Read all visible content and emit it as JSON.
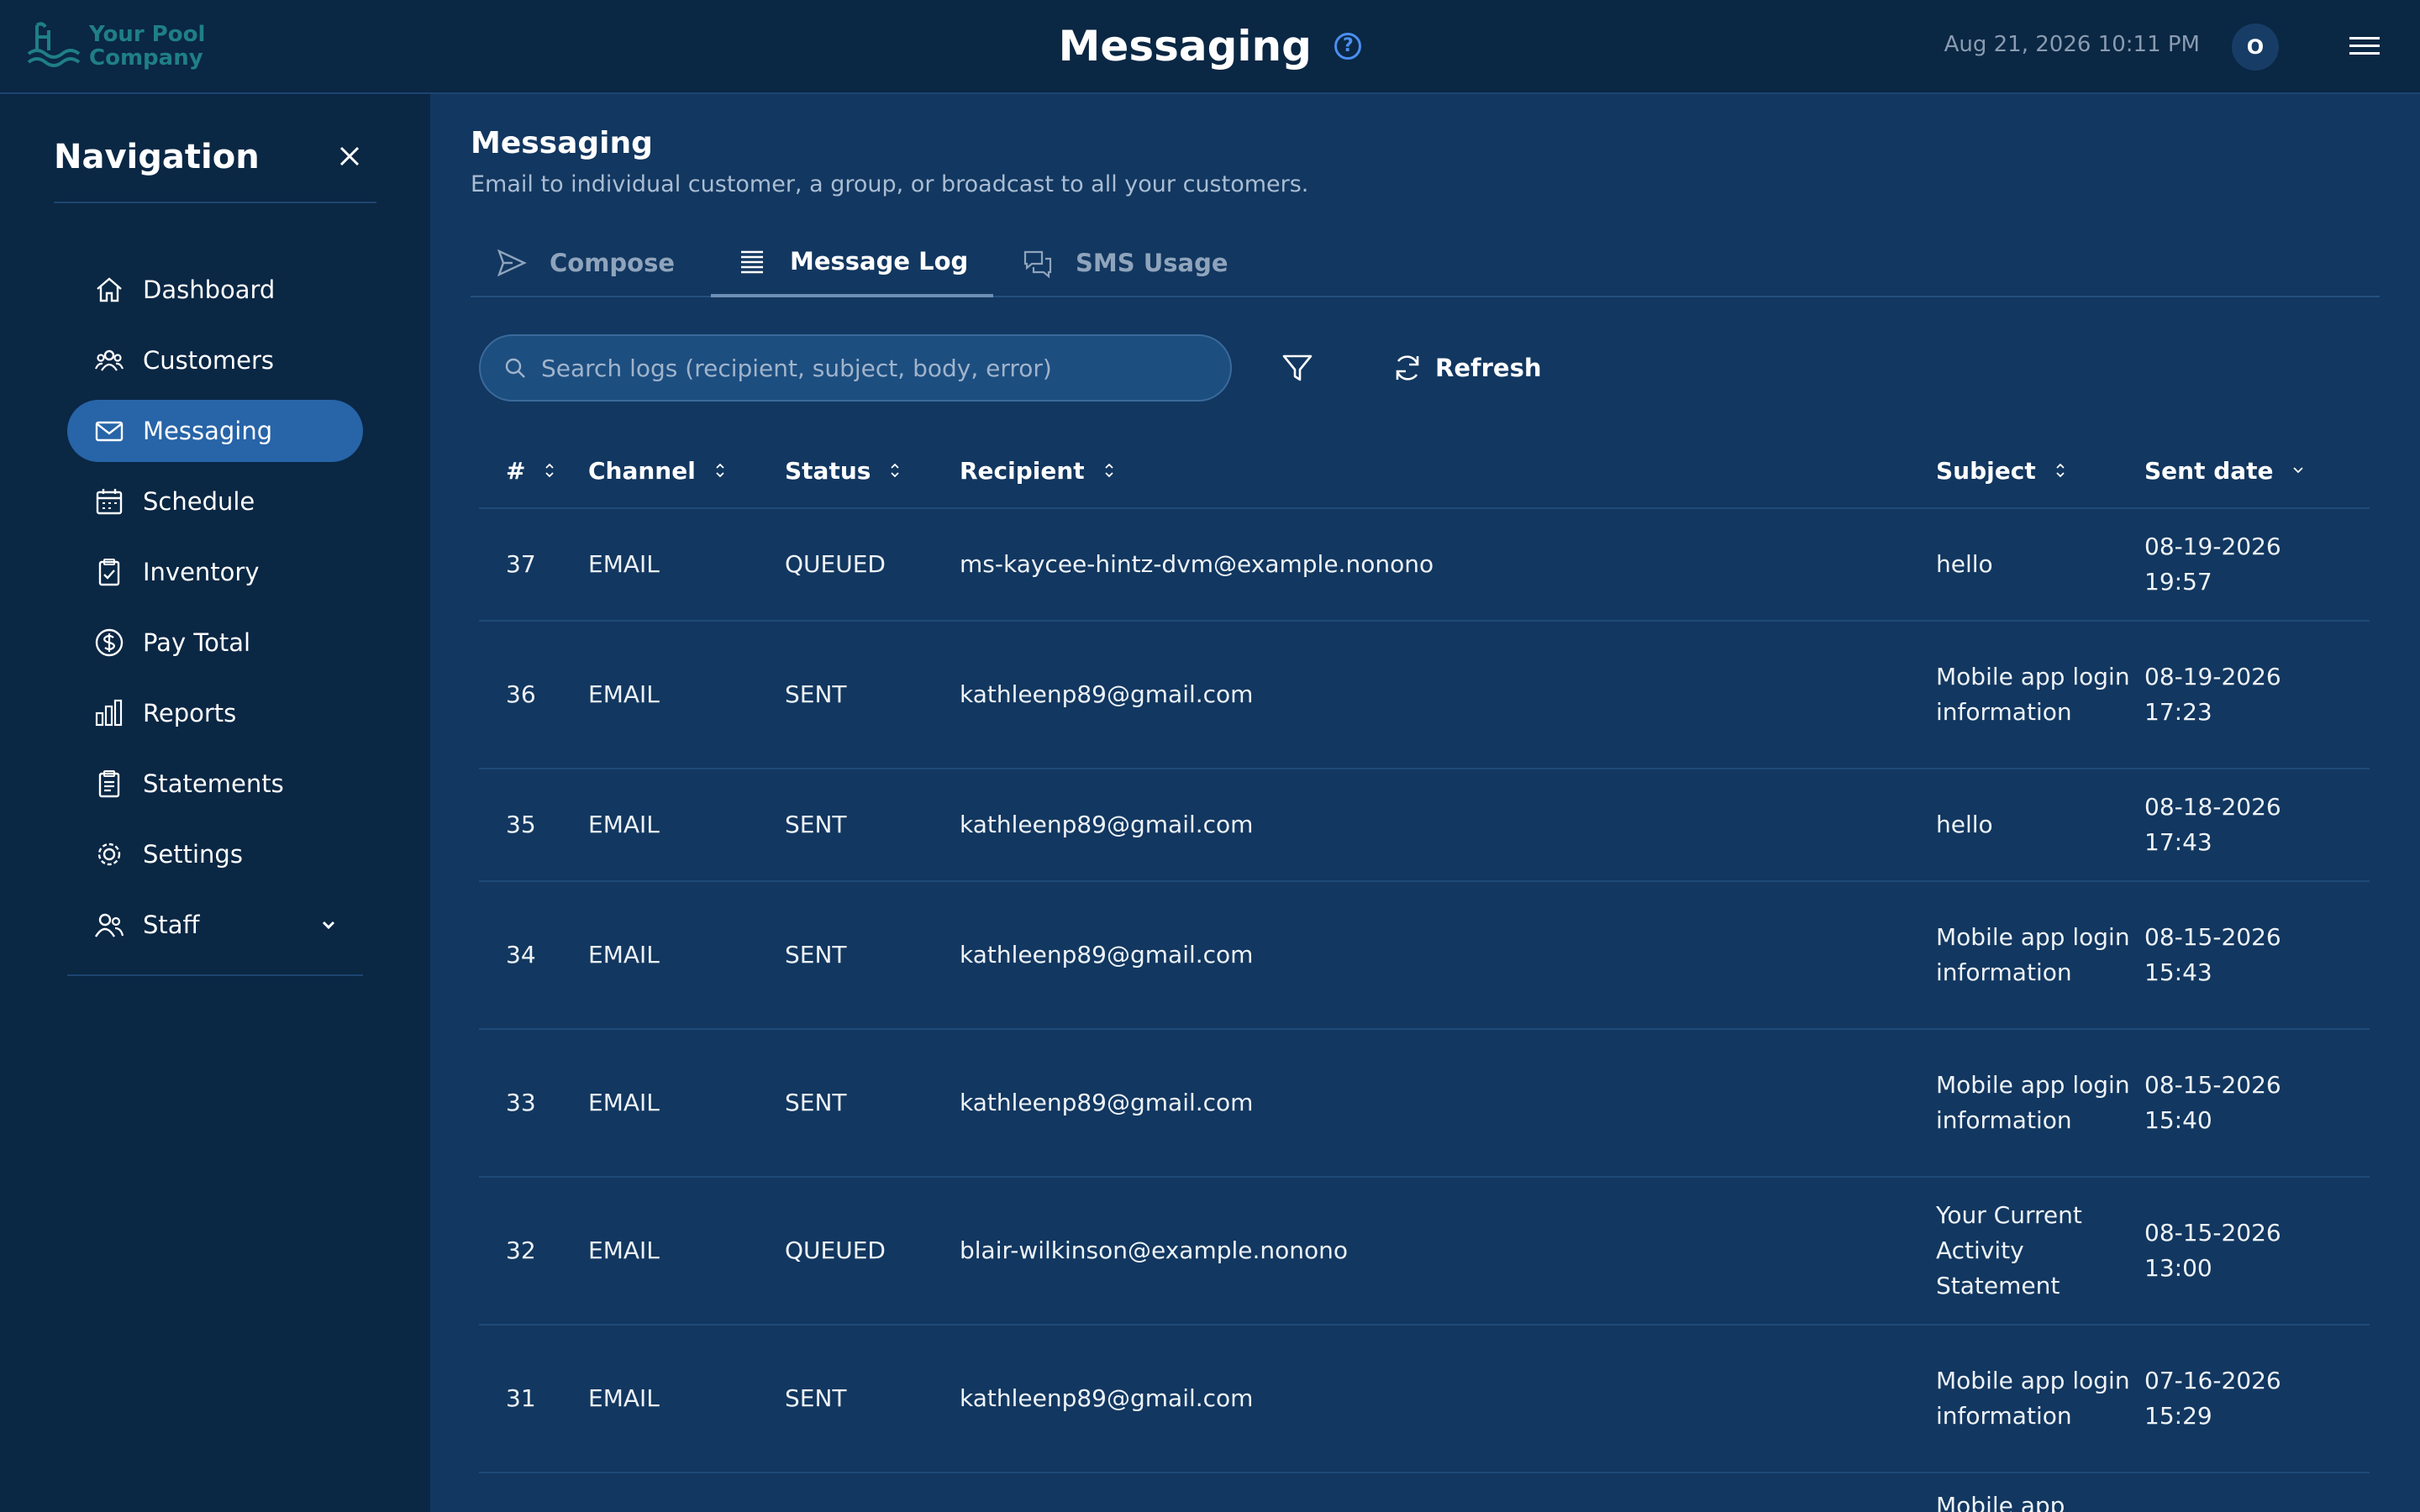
{
  "header": {
    "logo_line1": "Your Pool",
    "logo_line2": "Company",
    "title": "Messaging",
    "help_symbol": "?",
    "datetime": "Aug 21, 2026 10:11 PM",
    "avatar_initial": "O"
  },
  "sidebar": {
    "title": "Navigation",
    "items": [
      {
        "label": "Dashboard",
        "icon": "home-icon"
      },
      {
        "label": "Customers",
        "icon": "users-icon"
      },
      {
        "label": "Messaging",
        "icon": "mail-icon",
        "active": true
      },
      {
        "label": "Schedule",
        "icon": "calendar-icon"
      },
      {
        "label": "Inventory",
        "icon": "clipboard-check-icon"
      },
      {
        "label": "Pay Total",
        "icon": "dollar-icon"
      },
      {
        "label": "Reports",
        "icon": "bar-chart-icon"
      },
      {
        "label": "Statements",
        "icon": "statements-icon"
      },
      {
        "label": "Settings",
        "icon": "gear-icon"
      },
      {
        "label": "Staff",
        "icon": "staff-icon",
        "expandable": true
      }
    ]
  },
  "main": {
    "title": "Messaging",
    "subtitle": "Email to individual customer, a group, or broadcast to all your customers.",
    "tabs": [
      {
        "label": "Compose",
        "icon": "send-icon"
      },
      {
        "label": "Message Log",
        "icon": "list-icon",
        "active": true
      },
      {
        "label": "SMS Usage",
        "icon": "chat-icon"
      }
    ],
    "search_placeholder": "Search logs (recipient, subject, body, error)",
    "refresh_label": "Refresh"
  },
  "table": {
    "columns": [
      "#",
      "Channel",
      "Status",
      "Recipient",
      "Subject",
      "Sent date"
    ],
    "rows": [
      {
        "num": "37",
        "channel": "EMAIL",
        "status": "QUEUED",
        "recipient": "ms-kaycee-hintz-dvm@example.nonono",
        "subject": "hello",
        "date": "08-19-2026",
        "time": "19:57"
      },
      {
        "num": "36",
        "channel": "EMAIL",
        "status": "SENT",
        "recipient": "kathleenp89@gmail.com",
        "subject": "Mobile app login information",
        "date": "08-19-2026",
        "time": "17:23"
      },
      {
        "num": "35",
        "channel": "EMAIL",
        "status": "SENT",
        "recipient": "kathleenp89@gmail.com",
        "subject": "hello",
        "date": "08-18-2026",
        "time": "17:43"
      },
      {
        "num": "34",
        "channel": "EMAIL",
        "status": "SENT",
        "recipient": "kathleenp89@gmail.com",
        "subject": "Mobile app login information",
        "date": "08-15-2026",
        "time": "15:43"
      },
      {
        "num": "33",
        "channel": "EMAIL",
        "status": "SENT",
        "recipient": "kathleenp89@gmail.com",
        "subject": "Mobile app login information",
        "date": "08-15-2026",
        "time": "15:40"
      },
      {
        "num": "32",
        "channel": "EMAIL",
        "status": "QUEUED",
        "recipient": "blair-wilkinson@example.nonono",
        "subject": "Your Current Activity Statement",
        "date": "08-15-2026",
        "time": "13:00"
      },
      {
        "num": "31",
        "channel": "EMAIL",
        "status": "SENT",
        "recipient": "kathleenp89@gmail.com",
        "subject": "Mobile app login information",
        "date": "07-16-2026",
        "time": "15:29"
      },
      {
        "num": "",
        "channel": "",
        "status": "",
        "recipient": "",
        "subject": "Mobile app",
        "date": "",
        "time": ""
      }
    ]
  },
  "colors": {
    "background": "#123760",
    "sidebar": "#0a2744",
    "active_nav": "#2764a8",
    "logo": "#1f7f86",
    "help_accent": "#4b8ff0"
  }
}
